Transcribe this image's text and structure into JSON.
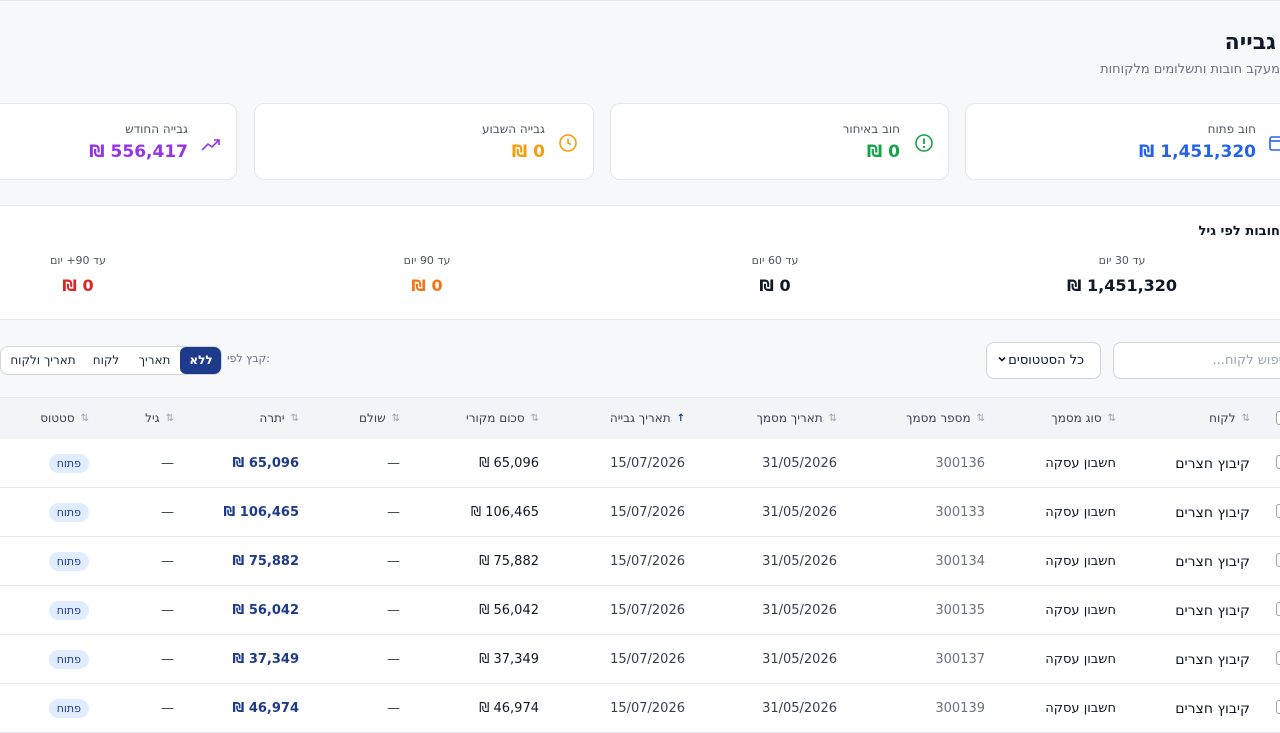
{
  "header": {
    "title": "גבייה",
    "subtitle": "מעקב חובות ותשלומים מלקוחות"
  },
  "kpis": [
    {
      "label": "חוב פתוח",
      "value": "₪ 1,451,320",
      "color": "#2563eb",
      "icon": "wallet-icon"
    },
    {
      "label": "חוב באיחור",
      "value": "₪ 0",
      "color": "#16a34a",
      "icon": "alert-circle-icon"
    },
    {
      "label": "גבייה השבוע",
      "value": "₪ 0",
      "color": "#f59e0b",
      "icon": "clock-icon"
    },
    {
      "label": "גבייה החודש",
      "value": "₪ 556,417",
      "color": "#9333ea",
      "icon": "trending-up-icon"
    }
  ],
  "aging": {
    "title": "חובות לפי גיל",
    "buckets": [
      {
        "label": "עד 30 יום",
        "value": "₪ 1,451,320",
        "color": "#111827"
      },
      {
        "label": "עד 60 יום",
        "value": "₪ 0",
        "color": "#111827"
      },
      {
        "label": "עד 90 יום",
        "value": "₪ 0",
        "color": "#f97316"
      },
      {
        "label": "עד 90+ יום",
        "value": "₪ 0",
        "color": "#dc2626"
      }
    ]
  },
  "filters": {
    "search_placeholder": "חיפוש לקוח...",
    "status_selected": "כל הסטטוסים",
    "group_label": "קבץ לפי:",
    "group_options": [
      "ללא",
      "תאריך",
      "לקוח",
      "תאריך ולקוח"
    ],
    "group_active": "ללא"
  },
  "table": {
    "columns": [
      "לקוח",
      "סוג מסמך",
      "מספר מסמך",
      "תאריך מסמך",
      "תאריך גבייה",
      "סכום מקורי",
      "שולם",
      "יתרה",
      "גיל",
      "סטטוס"
    ],
    "sorted_column": "תאריך גבייה",
    "rows": [
      {
        "customer": "קיבוץ חצרים",
        "doc_type": "חשבון עסקה",
        "doc_no": "300136",
        "doc_date": "31/05/2026",
        "due_date": "15/07/2026",
        "original": "₪ 65,096",
        "paid": "—",
        "balance": "₪ 65,096",
        "age": "—",
        "status": "פתוח"
      },
      {
        "customer": "קיבוץ חצרים",
        "doc_type": "חשבון עסקה",
        "doc_no": "300133",
        "doc_date": "31/05/2026",
        "due_date": "15/07/2026",
        "original": "₪ 106,465",
        "paid": "—",
        "balance": "₪ 106,465",
        "age": "—",
        "status": "פתוח"
      },
      {
        "customer": "קיבוץ חצרים",
        "doc_type": "חשבון עסקה",
        "doc_no": "300134",
        "doc_date": "31/05/2026",
        "due_date": "15/07/2026",
        "original": "₪ 75,882",
        "paid": "—",
        "balance": "₪ 75,882",
        "age": "—",
        "status": "פתוח"
      },
      {
        "customer": "קיבוץ חצרים",
        "doc_type": "חשבון עסקה",
        "doc_no": "300135",
        "doc_date": "31/05/2026",
        "due_date": "15/07/2026",
        "original": "₪ 56,042",
        "paid": "—",
        "balance": "₪ 56,042",
        "age": "—",
        "status": "פתוח"
      },
      {
        "customer": "קיבוץ חצרים",
        "doc_type": "חשבון עסקה",
        "doc_no": "300137",
        "doc_date": "31/05/2026",
        "due_date": "15/07/2026",
        "original": "₪ 37,349",
        "paid": "—",
        "balance": "₪ 37,349",
        "age": "—",
        "status": "פתוח"
      },
      {
        "customer": "קיבוץ חצרים",
        "doc_type": "חשבון עסקה",
        "doc_no": "300139",
        "doc_date": "31/05/2026",
        "due_date": "15/07/2026",
        "original": "₪ 46,974",
        "paid": "—",
        "balance": "₪ 46,974",
        "age": "—",
        "status": "פתוח"
      }
    ]
  }
}
